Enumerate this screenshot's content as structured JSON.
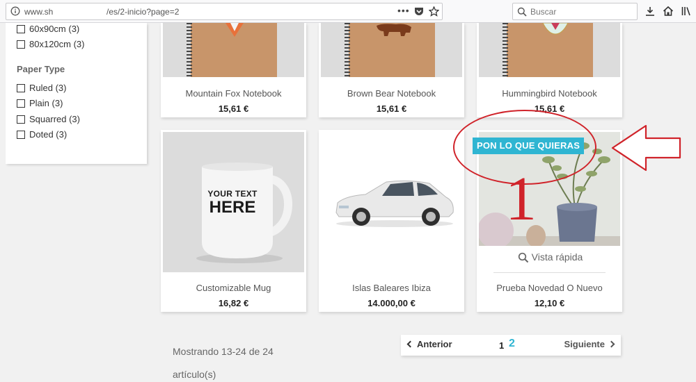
{
  "browser": {
    "url_host": "www.sh",
    "url_path": "/es/2-inicio?page=2",
    "menu_dots": "•••",
    "search_placeholder": "Buscar"
  },
  "sidebar": {
    "size_items": [
      {
        "label": "60x90cm (3)"
      },
      {
        "label": "80x120cm (3)"
      }
    ],
    "paper_type_title": "Paper Type",
    "paper_items": [
      {
        "label": "Ruled (3)"
      },
      {
        "label": "Plain (3)"
      },
      {
        "label": "Squarred (3)"
      },
      {
        "label": "Doted (3)"
      }
    ]
  },
  "products": [
    {
      "name": "Mountain Fox Notebook",
      "price": "15,61 €"
    },
    {
      "name": "Brown Bear Notebook",
      "price": "15,61 €"
    },
    {
      "name": "Hummingbird Notebook",
      "price": "15,61 €"
    },
    {
      "name": "Customizable Mug",
      "price": "16,82 €",
      "mug_text_1": "YOUR TEXT",
      "mug_text_2": "HERE"
    },
    {
      "name": "Islas Baleares Ibiza",
      "price": "14.000,00 €"
    },
    {
      "name": "Prueba Novedad O Nuevo",
      "price": "12,10 €",
      "badge": "PON LO QUE QUIERAS",
      "quick_view": "Vista rápida"
    }
  ],
  "annotation": {
    "number": "1",
    "color": "#d0232a"
  },
  "pagination": {
    "count_text": "Mostrando 13-24 de 24 artículo(s)",
    "prev_label": "Anterior",
    "pages": [
      "1",
      "2"
    ],
    "current_page": "2",
    "next_label": "Siguiente"
  },
  "colors": {
    "accent": "#2fb5d2",
    "annotation_red": "#d0232a"
  }
}
